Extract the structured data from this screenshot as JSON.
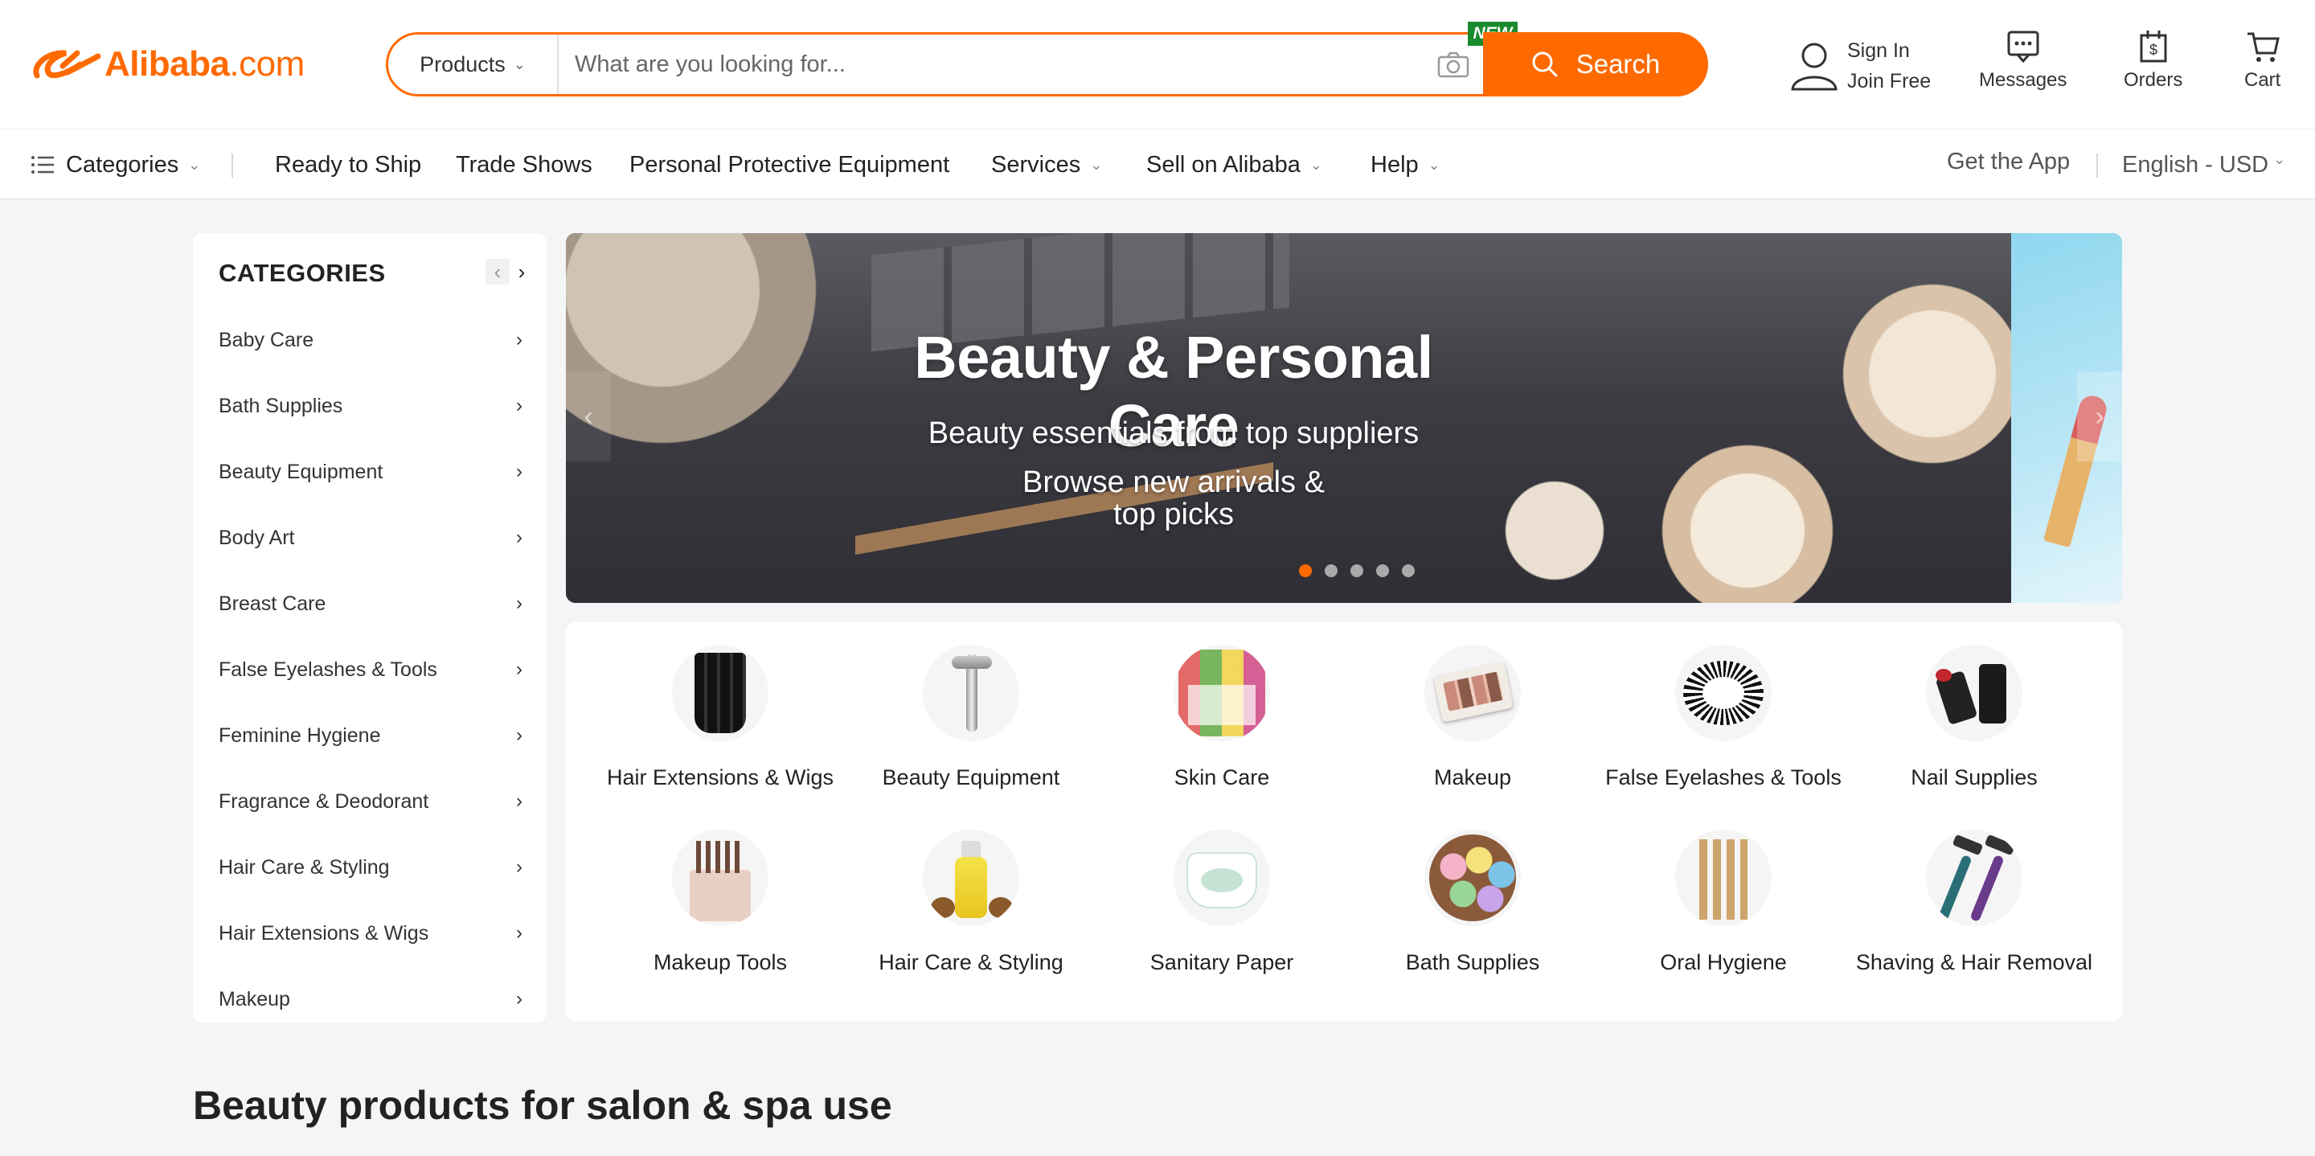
{
  "brand": {
    "name": "Alibaba",
    "tld": ".com",
    "color": "#ff6a00"
  },
  "search": {
    "category": "Products",
    "placeholder": "What are you looking for...",
    "badge": "NEW",
    "button": "Search"
  },
  "header_actions": {
    "sign_in": "Sign In",
    "join_free": "Join Free",
    "messages": "Messages",
    "orders": "Orders",
    "cart": "Cart"
  },
  "nav": {
    "categories": "Categories",
    "ready_to_ship": "Ready to Ship",
    "trade_shows": "Trade Shows",
    "ppe": "Personal Protective Equipment",
    "services": "Services",
    "sell": "Sell on Alibaba",
    "help": "Help",
    "get_app": "Get the App",
    "locale": "English - USD"
  },
  "sidebar": {
    "title": "CATEGORIES",
    "items": [
      {
        "label": "Baby Care"
      },
      {
        "label": "Bath Supplies"
      },
      {
        "label": "Beauty Equipment"
      },
      {
        "label": "Body Art"
      },
      {
        "label": "Breast Care"
      },
      {
        "label": "False Eyelashes & Tools"
      },
      {
        "label": "Feminine Hygiene"
      },
      {
        "label": "Fragrance & Deodorant"
      },
      {
        "label": "Hair Care & Styling"
      },
      {
        "label": "Hair Extensions & Wigs"
      },
      {
        "label": "Makeup"
      }
    ]
  },
  "banner": {
    "title": "Beauty & Personal Care",
    "subtitle": "Beauty essentials from top suppliers",
    "cta": "Browse new arrivals & top picks",
    "slide_count": 5,
    "active_slide": 1
  },
  "tiles": [
    {
      "label": "Hair Extensions & Wigs",
      "icon": "hair-bundles-icon"
    },
    {
      "label": "Beauty Equipment",
      "icon": "face-roller-icon"
    },
    {
      "label": "Skin Care",
      "icon": "face-mask-icon"
    },
    {
      "label": "Makeup",
      "icon": "eyeshadow-palette-icon"
    },
    {
      "label": "False Eyelashes & Tools",
      "icon": "eyelashes-icon"
    },
    {
      "label": "Nail Supplies",
      "icon": "nail-polish-icon"
    },
    {
      "label": "Makeup Tools",
      "icon": "brush-set-icon"
    },
    {
      "label": "Hair Care & Styling",
      "icon": "hair-oil-icon"
    },
    {
      "label": "Sanitary Paper",
      "icon": "diaper-icon"
    },
    {
      "label": "Bath Supplies",
      "icon": "bath-bombs-icon"
    },
    {
      "label": "Oral Hygiene",
      "icon": "toothbrush-icon"
    },
    {
      "label": "Shaving & Hair Removal",
      "icon": "razor-icon"
    }
  ],
  "section": {
    "title": "Beauty products for salon & spa use"
  }
}
